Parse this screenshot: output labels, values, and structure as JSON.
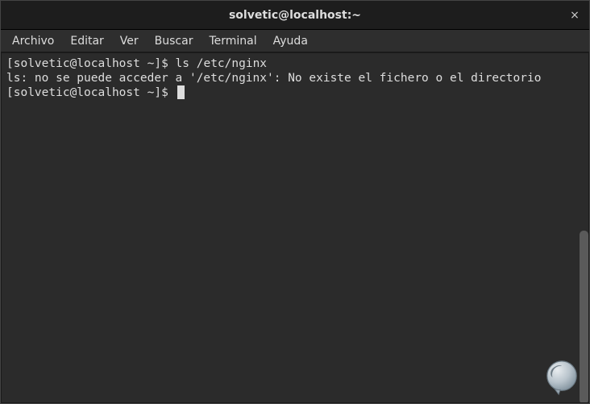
{
  "window": {
    "title": "solvetic@localhost:~",
    "close_label": "×"
  },
  "menubar": {
    "items": [
      "Archivo",
      "Editar",
      "Ver",
      "Buscar",
      "Terminal",
      "Ayuda"
    ]
  },
  "terminal": {
    "lines": [
      {
        "prompt_open": "[",
        "user_host": "solvetic@localhost ~",
        "prompt_close": "]$ ",
        "command": "ls /etc/nginx"
      },
      {
        "output": "ls: no se puede acceder a '/etc/nginx': No existe el fichero o el directorio"
      },
      {
        "prompt_open": "[",
        "user_host": "solvetic@localhost ~",
        "prompt_close": "]$ ",
        "command": ""
      }
    ]
  }
}
